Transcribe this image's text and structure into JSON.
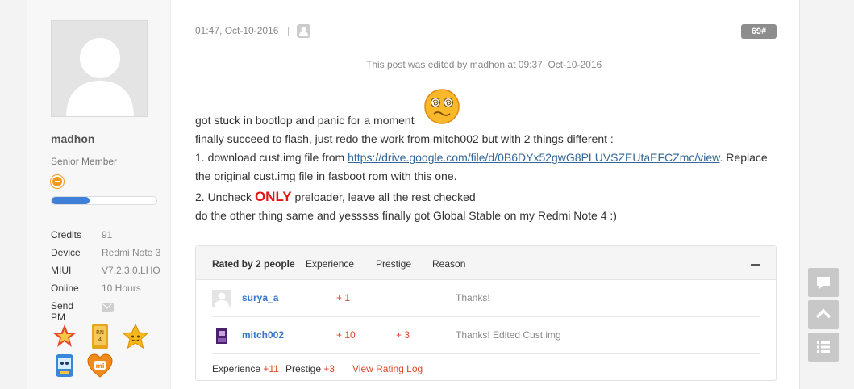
{
  "user": {
    "name": "madhon",
    "group": "Senior Member",
    "level_progress": 0.36,
    "info": [
      {
        "key": "Credits",
        "value": "91"
      },
      {
        "key": "Device",
        "value": "Redmi Note 3"
      },
      {
        "key": "MIUI",
        "value": "V7.2.3.0.LHO"
      },
      {
        "key": "Online",
        "value": "10 Hours"
      },
      {
        "key": "Send PM",
        "value": ""
      }
    ],
    "badge_icons": [
      "star-badge-icon",
      "rn4-badge-icon",
      "smiling-star-badge-icon",
      "phone-mascot-badge-icon",
      "mi-heart-badge-icon"
    ]
  },
  "post": {
    "date": "01:47, Oct-10-2016",
    "separator": "|",
    "floor": "69#",
    "edited_note": "This post was edited by madhon at 09:37, Oct-10-2016",
    "lines": {
      "l1": "got stuck in bootlop and panic for a moment",
      "l2": "finally succeed to flash, just redo the work from mitch002 but with 2 things different :",
      "l3_pre": "1. download cust.img file from ",
      "l3_link": "https://drive.google.com/file/d/0B6DYx52gwG8PLUVSZEUtaEFCZmc/view",
      "l3_post": ". Replace",
      "l4": "the original cust.img file in fasboot rom with this one.",
      "l5_pre": "2. Uncheck ",
      "l5_only": "ONLY",
      "l5_post": " preloader, leave all the rest checked",
      "l6": "do the other thing same and yesssss finally got Global Stable on my Redmi Note 4 :)"
    }
  },
  "rating": {
    "title": "Rated by 2 people",
    "col_experience": "Experience",
    "col_prestige": "Prestige",
    "col_reason": "Reason",
    "rows": [
      {
        "name": "surya_a",
        "experience": "+ 1",
        "prestige": "",
        "reason": "Thanks!"
      },
      {
        "name": "mitch002",
        "experience": "+ 10",
        "prestige": "+ 3",
        "reason": "Thanks! Edited Cust.img"
      }
    ],
    "footer": {
      "exp_label": "Experience",
      "exp_value": "+11",
      "pre_label": "Prestige",
      "pre_value": "+3",
      "log_link": "View Rating Log"
    }
  },
  "colors": {
    "accent_red": "#e0462b",
    "link_blue": "#3a76c8",
    "progress_blue": "#3f7fd8"
  }
}
